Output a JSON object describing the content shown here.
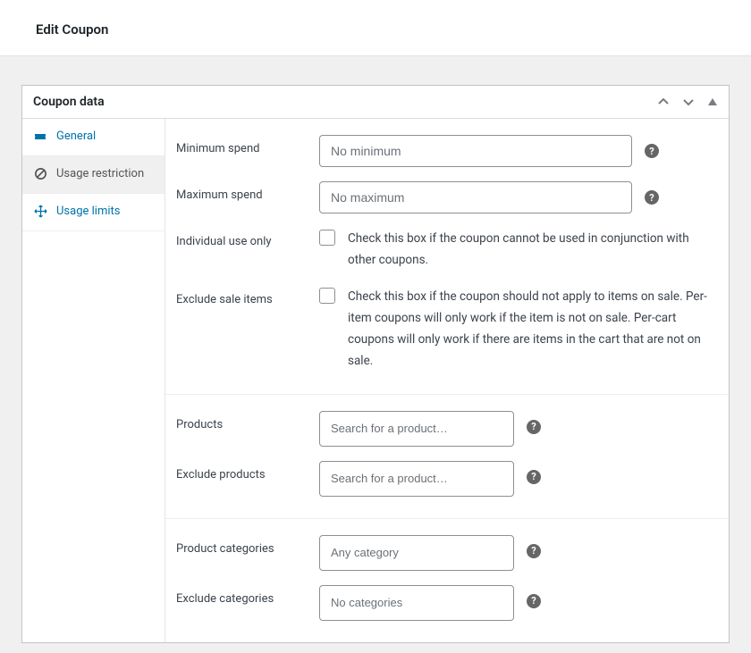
{
  "header": {
    "title": "Edit Coupon"
  },
  "metabox": {
    "title": "Coupon data"
  },
  "tabs": {
    "general": {
      "label": "General"
    },
    "usage_restriction": {
      "label": "Usage restriction"
    },
    "usage_limits": {
      "label": "Usage limits"
    }
  },
  "fields": {
    "min_spend": {
      "label": "Minimum spend",
      "placeholder": "No minimum"
    },
    "max_spend": {
      "label": "Maximum spend",
      "placeholder": "No maximum"
    },
    "individual_use": {
      "label": "Individual use only",
      "description": "Check this box if the coupon cannot be used in conjunction with other coupons."
    },
    "exclude_sale": {
      "label": "Exclude sale items",
      "description": "Check this box if the coupon should not apply to items on sale. Per-item coupons will only work if the item is not on sale. Per-cart coupons will only work if there are items in the cart that are not on sale."
    },
    "products": {
      "label": "Products",
      "placeholder": "Search for a product…"
    },
    "exclude_products": {
      "label": "Exclude products",
      "placeholder": "Search for a product…"
    },
    "product_categories": {
      "label": "Product categories",
      "placeholder": "Any category"
    },
    "exclude_categories": {
      "label": "Exclude categories",
      "placeholder": "No categories"
    }
  },
  "glyphs": {
    "help": "?"
  }
}
